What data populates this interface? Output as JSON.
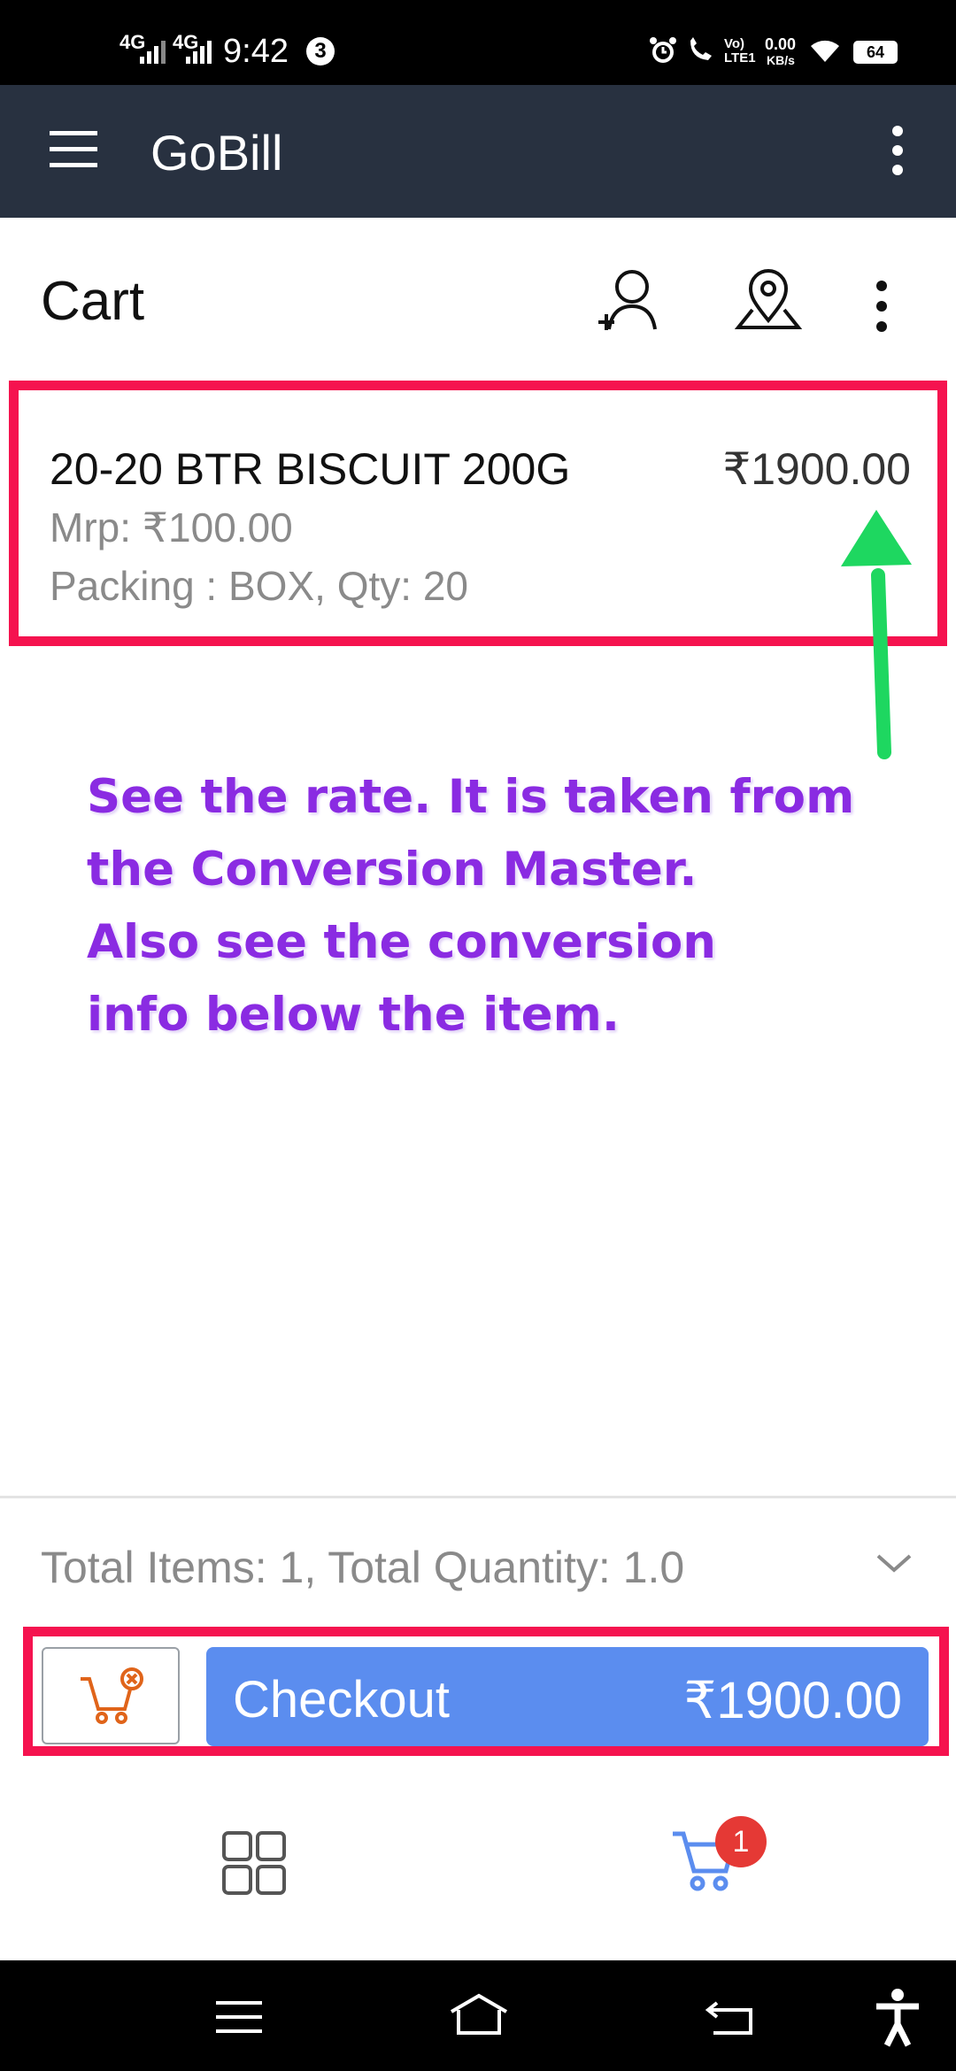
{
  "status_bar": {
    "network1": "4G",
    "network2": "4G",
    "time": "9:42",
    "notification_count": "3",
    "volte": "Vo) LTE1",
    "speed": "0.00",
    "speed_unit": "KB/s",
    "battery": "64"
  },
  "app_bar": {
    "title": "GoBill",
    "menu_icon": "hamburger-menu-icon",
    "overflow_icon": "vertical-dots-icon"
  },
  "cart": {
    "title": "Cart",
    "actions": [
      "add-customer-icon",
      "location-pin-icon",
      "vertical-dots-icon"
    ]
  },
  "item": {
    "name": "20-20 BTR BISCUIT 200G",
    "price": "₹1900.00",
    "mrp": "Mrp: ₹100.00",
    "packing": "Packing : BOX, Qty: 20"
  },
  "annotation": {
    "lines": [
      "See the rate. It is taken from",
      "the Conversion Master.",
      "Also see the conversion",
      "info below the item."
    ]
  },
  "summary": {
    "totals": "Total Items: 1, Total Quantity: 1.0"
  },
  "checkout": {
    "label": "Checkout",
    "amount": "₹1900.00"
  },
  "bottom_nav": {
    "cart_badge": "1"
  },
  "colors": {
    "app_bar": "#283140",
    "highlight": "#f5134f",
    "checkout": "#5b8def",
    "annotation": "#8a2be2",
    "arrow": "#1ed760"
  }
}
